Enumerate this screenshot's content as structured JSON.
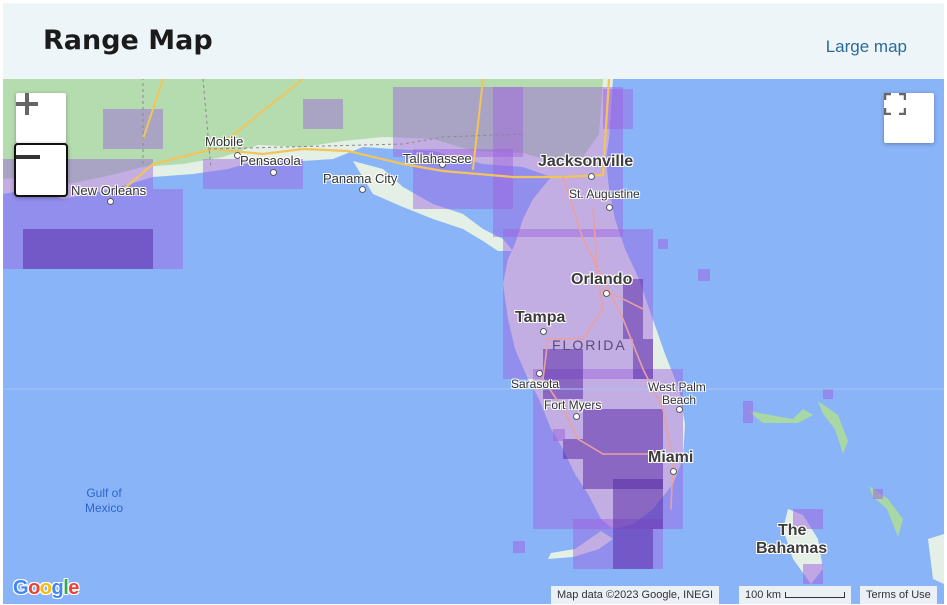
{
  "header": {
    "title": "Range Map",
    "large_map_link": "Large map"
  },
  "map": {
    "colors": {
      "water": "#8ab4f8",
      "land": "#e4efe6",
      "park": "#a8d8a4",
      "range": "#9b5fe0",
      "road": "#f2c45a"
    },
    "controls": {
      "zoom_in_icon": "plus-icon",
      "zoom_out_icon": "minus-icon",
      "fullscreen_icon": "fullscreen-icon"
    },
    "cities": {
      "jacksonville": "Jacksonville",
      "orlando": "Orlando",
      "tampa": "Tampa",
      "miami": "Miami",
      "new_orleans": "New Orleans",
      "mobile": "Mobile",
      "pensacola": "Pensacola",
      "panama_city": "Panama City",
      "tallahassee": "Tallahassee",
      "st_augustine": "St. Augustine",
      "sarasota": "Sarasota",
      "fort_myers": "Fort Myers",
      "west_palm_beach_line1": "West Palm",
      "west_palm_beach_line2": "Beach",
      "bahamas_line1": "The",
      "bahamas_line2": "Bahamas"
    },
    "state_label": "FLORIDA",
    "water_label_line1": "Gulf of",
    "water_label_line2": "Mexico",
    "google_logo": "Google",
    "attribution": {
      "map_data": "Map data ©2023 Google, INEGI",
      "scale": "100 km",
      "terms": "Terms of Use"
    }
  }
}
